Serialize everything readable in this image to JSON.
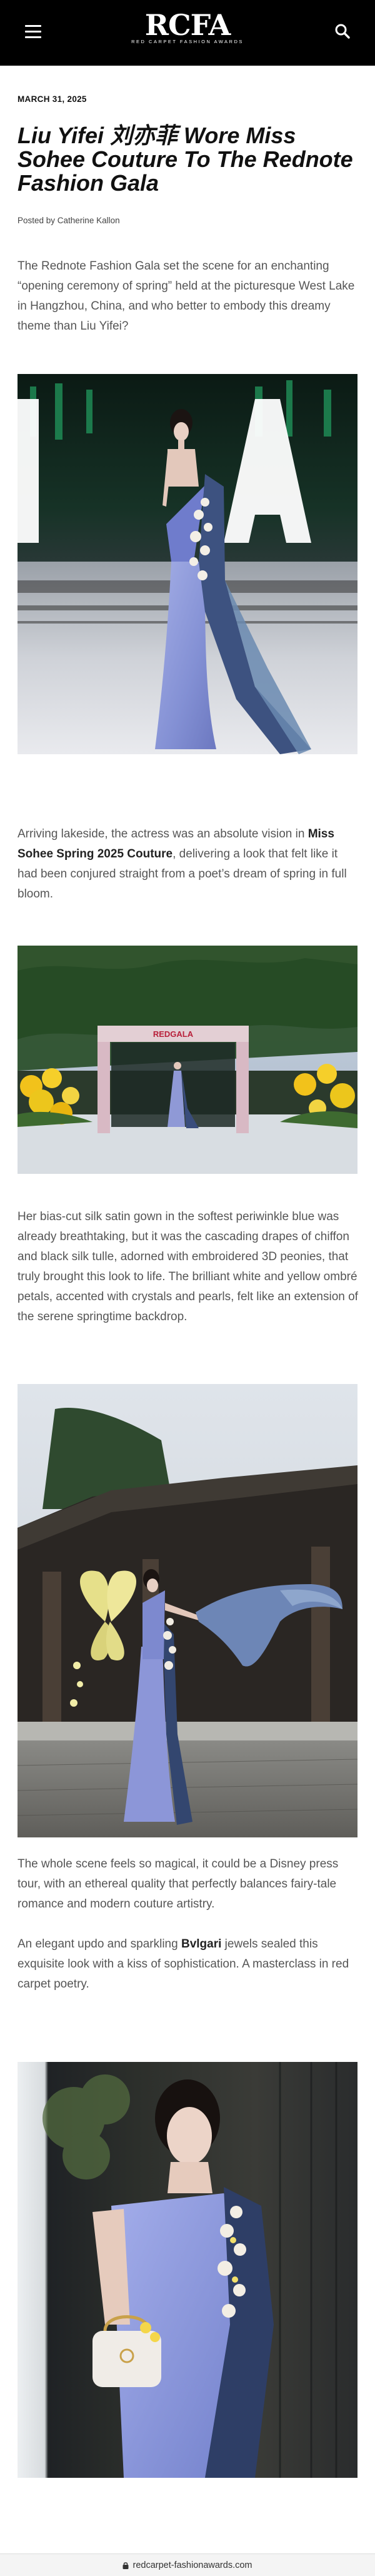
{
  "header": {
    "logo_text": "RCFA",
    "logo_tagline": "RED CARPET FASHION AWARDS",
    "menu_icon": "hamburger-menu-icon",
    "search_icon": "search-icon",
    "background": "#000000"
  },
  "article": {
    "date": "MARCH 31, 2025",
    "title": "Liu Yifei 刘亦菲 Wore Miss Sohee Couture To The Rednote Fashion Gala",
    "byline": "Posted by Catherine Kallon",
    "paragraphs": {
      "p1": "The Rednote Fashion Gala set the scene for an enchanting “opening ceremony of spring” held at the picturesque West Lake in Hangzhou, China, and who better to embody this dreamy theme than Liu Yifei?",
      "p2_before": "Arriving lakeside, the actress was an absolute vision in ",
      "p2_bold": "Miss Sohee Spring 2025 Couture",
      "p2_after": ", delivering a look that felt like it had been conjured straight from a poet’s dream of spring in full bloom.",
      "p3": "Her bias-cut silk satin gown in the softest periwinkle blue was already breathtaking, but it was the cascading drapes of chiffon and black silk tulle, adorned with embroidered 3D peonies, that truly brought this look to life. The brilliant white and yellow ombré petals, accented with crystals and pearls, felt like an extension of the serene springtime backdrop.",
      "p4": "The whole scene feels so magical, it could be a Disney press tour, with an ethereal quality that perfectly balances fairy-tale romance and modern couture artistry.",
      "p5_before": "An elegant updo and sparkling ",
      "p5_bold": "Bvlgari",
      "p5_after": " jewels sealed this exquisite look with a kiss of sophistication. A masterclass in red carpet poetry."
    },
    "photo2_sign": "REDGALA",
    "colors": {
      "gown": "#8c96d8",
      "drape": "#3b4f7e",
      "text": "#555555"
    }
  },
  "footer": {
    "url": "redcarpet-fashionawards.com",
    "lock_icon": "lock-icon"
  }
}
